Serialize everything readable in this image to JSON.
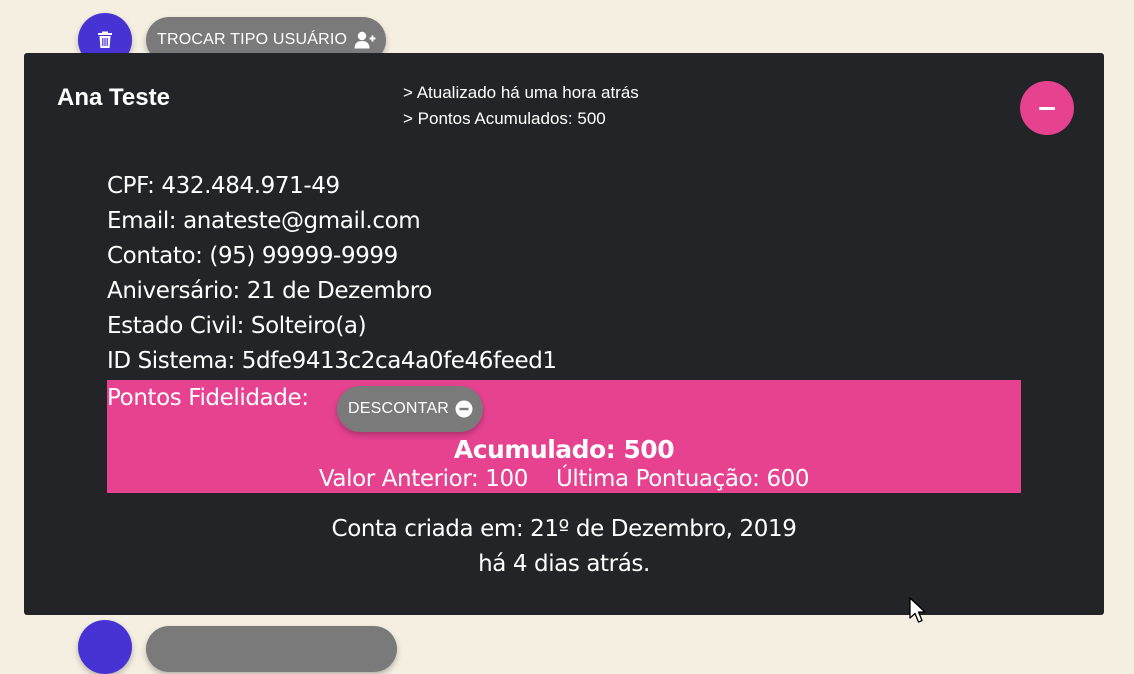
{
  "toolbar": {
    "delete_icon": "trash-icon",
    "switch_user_type_label": "TROCAR TIPO USUÁRIO",
    "switch_user_type_icon": "add-user-icon"
  },
  "card": {
    "name": "Ana Teste",
    "updated": "> Atualizado há uma hora atrás",
    "points_summary": "> Pontos Acumulados: 500",
    "collapse_icon": "minus-icon",
    "details": {
      "cpf": "CPF: 432.484.971-49",
      "email": "Email: anateste@gmail.com",
      "contact": "Contato: (95) 99999-9999",
      "birthday": "Aniversário: 21 de Dezembro",
      "civil_status": "Estado Civil: Solteiro(a)",
      "system_id": "ID Sistema: 5dfe9413c2ca4a0fe46feed1"
    },
    "loyalty": {
      "label": "Pontos Fidelidade:",
      "discount_label": "DESCONTAR",
      "discount_icon": "minus-circle-icon",
      "accumulated": "Acumulado: 500",
      "previous": "Valor Anterior: 100",
      "last_score": "Última Pontuação: 600"
    },
    "created": "Conta criada em: 21º de Dezembro, 2019",
    "created_ago": "há 4 dias atrás."
  },
  "colors": {
    "background": "#f5efe2",
    "card": "#232427",
    "accent_pink": "#e64290",
    "accent_purple": "#4733d3",
    "pill_gray": "#7a7a7a"
  }
}
